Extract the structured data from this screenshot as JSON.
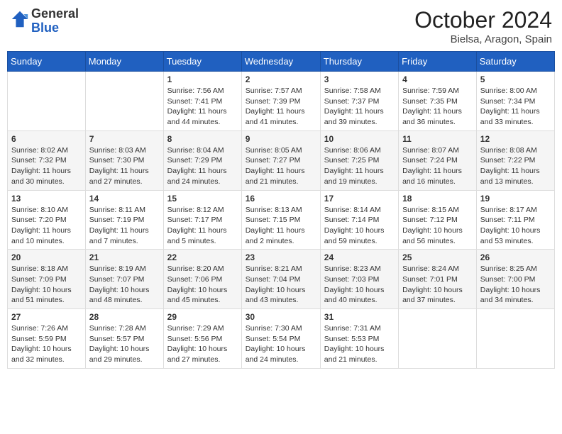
{
  "header": {
    "logo_general": "General",
    "logo_blue": "Blue",
    "month_title": "October 2024",
    "location": "Bielsa, Aragon, Spain"
  },
  "days_of_week": [
    "Sunday",
    "Monday",
    "Tuesday",
    "Wednesday",
    "Thursday",
    "Friday",
    "Saturday"
  ],
  "weeks": [
    [
      {
        "num": "",
        "info": ""
      },
      {
        "num": "",
        "info": ""
      },
      {
        "num": "1",
        "info": "Sunrise: 7:56 AM\nSunset: 7:41 PM\nDaylight: 11 hours and 44 minutes."
      },
      {
        "num": "2",
        "info": "Sunrise: 7:57 AM\nSunset: 7:39 PM\nDaylight: 11 hours and 41 minutes."
      },
      {
        "num": "3",
        "info": "Sunrise: 7:58 AM\nSunset: 7:37 PM\nDaylight: 11 hours and 39 minutes."
      },
      {
        "num": "4",
        "info": "Sunrise: 7:59 AM\nSunset: 7:35 PM\nDaylight: 11 hours and 36 minutes."
      },
      {
        "num": "5",
        "info": "Sunrise: 8:00 AM\nSunset: 7:34 PM\nDaylight: 11 hours and 33 minutes."
      }
    ],
    [
      {
        "num": "6",
        "info": "Sunrise: 8:02 AM\nSunset: 7:32 PM\nDaylight: 11 hours and 30 minutes."
      },
      {
        "num": "7",
        "info": "Sunrise: 8:03 AM\nSunset: 7:30 PM\nDaylight: 11 hours and 27 minutes."
      },
      {
        "num": "8",
        "info": "Sunrise: 8:04 AM\nSunset: 7:29 PM\nDaylight: 11 hours and 24 minutes."
      },
      {
        "num": "9",
        "info": "Sunrise: 8:05 AM\nSunset: 7:27 PM\nDaylight: 11 hours and 21 minutes."
      },
      {
        "num": "10",
        "info": "Sunrise: 8:06 AM\nSunset: 7:25 PM\nDaylight: 11 hours and 19 minutes."
      },
      {
        "num": "11",
        "info": "Sunrise: 8:07 AM\nSunset: 7:24 PM\nDaylight: 11 hours and 16 minutes."
      },
      {
        "num": "12",
        "info": "Sunrise: 8:08 AM\nSunset: 7:22 PM\nDaylight: 11 hours and 13 minutes."
      }
    ],
    [
      {
        "num": "13",
        "info": "Sunrise: 8:10 AM\nSunset: 7:20 PM\nDaylight: 11 hours and 10 minutes."
      },
      {
        "num": "14",
        "info": "Sunrise: 8:11 AM\nSunset: 7:19 PM\nDaylight: 11 hours and 7 minutes."
      },
      {
        "num": "15",
        "info": "Sunrise: 8:12 AM\nSunset: 7:17 PM\nDaylight: 11 hours and 5 minutes."
      },
      {
        "num": "16",
        "info": "Sunrise: 8:13 AM\nSunset: 7:15 PM\nDaylight: 11 hours and 2 minutes."
      },
      {
        "num": "17",
        "info": "Sunrise: 8:14 AM\nSunset: 7:14 PM\nDaylight: 10 hours and 59 minutes."
      },
      {
        "num": "18",
        "info": "Sunrise: 8:15 AM\nSunset: 7:12 PM\nDaylight: 10 hours and 56 minutes."
      },
      {
        "num": "19",
        "info": "Sunrise: 8:17 AM\nSunset: 7:11 PM\nDaylight: 10 hours and 53 minutes."
      }
    ],
    [
      {
        "num": "20",
        "info": "Sunrise: 8:18 AM\nSunset: 7:09 PM\nDaylight: 10 hours and 51 minutes."
      },
      {
        "num": "21",
        "info": "Sunrise: 8:19 AM\nSunset: 7:07 PM\nDaylight: 10 hours and 48 minutes."
      },
      {
        "num": "22",
        "info": "Sunrise: 8:20 AM\nSunset: 7:06 PM\nDaylight: 10 hours and 45 minutes."
      },
      {
        "num": "23",
        "info": "Sunrise: 8:21 AM\nSunset: 7:04 PM\nDaylight: 10 hours and 43 minutes."
      },
      {
        "num": "24",
        "info": "Sunrise: 8:23 AM\nSunset: 7:03 PM\nDaylight: 10 hours and 40 minutes."
      },
      {
        "num": "25",
        "info": "Sunrise: 8:24 AM\nSunset: 7:01 PM\nDaylight: 10 hours and 37 minutes."
      },
      {
        "num": "26",
        "info": "Sunrise: 8:25 AM\nSunset: 7:00 PM\nDaylight: 10 hours and 34 minutes."
      }
    ],
    [
      {
        "num": "27",
        "info": "Sunrise: 7:26 AM\nSunset: 5:59 PM\nDaylight: 10 hours and 32 minutes."
      },
      {
        "num": "28",
        "info": "Sunrise: 7:28 AM\nSunset: 5:57 PM\nDaylight: 10 hours and 29 minutes."
      },
      {
        "num": "29",
        "info": "Sunrise: 7:29 AM\nSunset: 5:56 PM\nDaylight: 10 hours and 27 minutes."
      },
      {
        "num": "30",
        "info": "Sunrise: 7:30 AM\nSunset: 5:54 PM\nDaylight: 10 hours and 24 minutes."
      },
      {
        "num": "31",
        "info": "Sunrise: 7:31 AM\nSunset: 5:53 PM\nDaylight: 10 hours and 21 minutes."
      },
      {
        "num": "",
        "info": ""
      },
      {
        "num": "",
        "info": ""
      }
    ]
  ]
}
